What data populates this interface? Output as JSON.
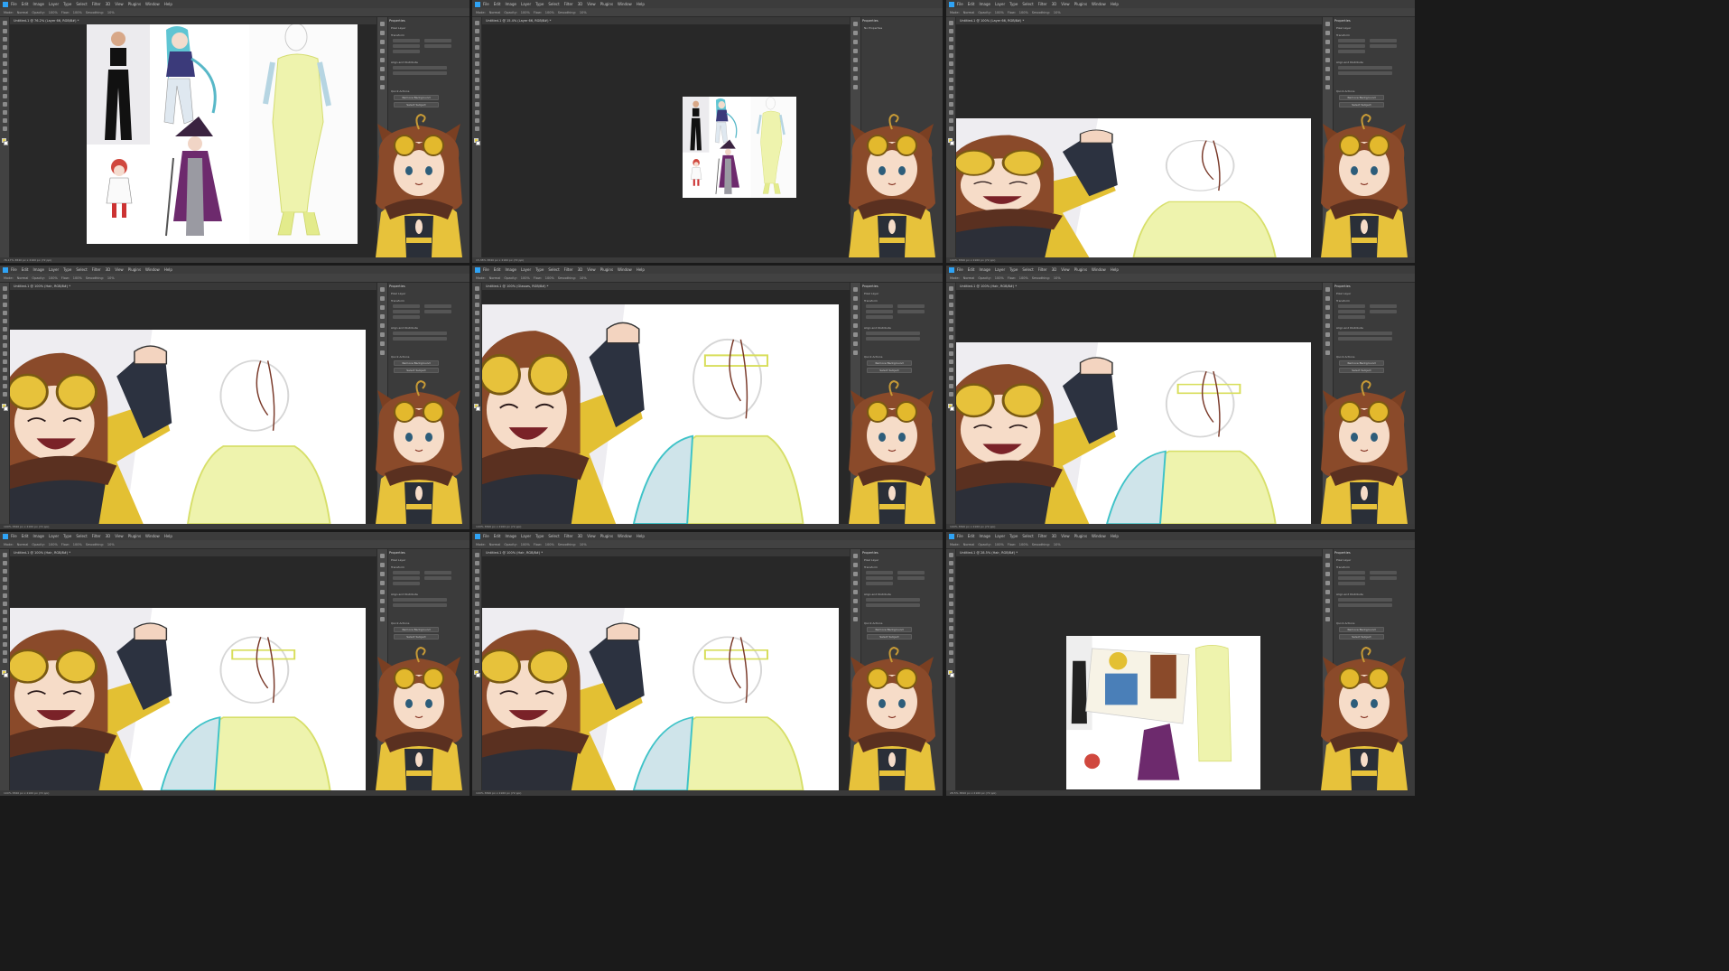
{
  "app": {
    "menu": [
      "File",
      "Edit",
      "Image",
      "Layer",
      "Type",
      "Select",
      "Filter",
      "3D",
      "View",
      "Plugins",
      "Window",
      "Help"
    ],
    "options_labels": [
      "Mode:",
      "Normal",
      "Opacity:",
      "100%",
      "Flow:",
      "100%",
      "Smoothing:",
      "10%"
    ]
  },
  "panels": [
    {
      "doc_tab": "Untitled-1 @ 76.2% (Layer 66, RGB/8#) *",
      "status": "76.17%  3840 px x 2160 px (72 ppi)",
      "props_title": "Properties",
      "props_sub": "Pixel Layer",
      "section1": "Transform",
      "section2": "Align and Distribute",
      "section3": "Quick Actions",
      "btn1": "Remove Background",
      "btn2": "Select Subject"
    },
    {
      "doc_tab": "Untitled-1 @ 15.4% (Layer 66, RGB/8#) *",
      "status": "15.38%  3840 px x 2160 px (72 ppi)",
      "props_title": "Properties",
      "props_sub": "No Properties",
      "section1": "",
      "section2": "",
      "section3": "",
      "btn1": "",
      "btn2": ""
    },
    {
      "doc_tab": "Untitled-1 @ 100% (Layer 66, RGB/8#) *",
      "status": "100%  3840 px x 2160 px (72 ppi)",
      "props_title": "Properties",
      "props_sub": "Pixel Layer",
      "section1": "Transform",
      "section2": "Align and Distribute",
      "section3": "Quick Actions",
      "btn1": "Remove Background",
      "btn2": "Select Subject"
    },
    {
      "doc_tab": "Untitled-1 @ 100% (Hair, RGB/8#) *",
      "status": "100%  3840 px x 2160 px (72 ppi)",
      "props_title": "Properties",
      "props_sub": "Pixel Layer",
      "section1": "Transform",
      "section2": "Align and Distribute",
      "section3": "Quick Actions",
      "btn1": "Remove Background",
      "btn2": "Select Subject"
    },
    {
      "doc_tab": "Untitled-1 @ 100% (Glasses, RGB/8#) *",
      "status": "100%  3840 px x 2160 px (72 ppi)",
      "props_title": "Properties",
      "props_sub": "Pixel Layer",
      "section1": "Transform",
      "section2": "Align and Distribute",
      "section3": "Quick Actions",
      "btn1": "Remove Background",
      "btn2": "Select Subject"
    },
    {
      "doc_tab": "Untitled-1 @ 100% (Hair, RGB/8#) *",
      "status": "100%  3840 px x 2160 px (72 ppi)",
      "props_title": "Properties",
      "props_sub": "Pixel Layer",
      "section1": "Transform",
      "section2": "Align and Distribute",
      "section3": "Quick Actions",
      "btn1": "Remove Background",
      "btn2": "Select Subject"
    },
    {
      "doc_tab": "Untitled-1 @ 100% (Hair, RGB/8#) *",
      "status": "100%  3840 px x 2160 px (72 ppi)",
      "props_title": "Properties",
      "props_sub": "Pixel Layer",
      "section1": "Transform",
      "section2": "Align and Distribute",
      "section3": "Quick Actions",
      "btn1": "Remove Background",
      "btn2": "Select Subject"
    },
    {
      "doc_tab": "Untitled-1 @ 100% (Hair, RGB/8#) *",
      "status": "100%  3840 px x 2160 px (72 ppi)",
      "props_title": "Properties",
      "props_sub": "Pixel Layer",
      "section1": "Transform",
      "section2": "Align and Distribute",
      "section3": "Quick Actions",
      "btn1": "Remove Background",
      "btn2": "Select Subject"
    },
    {
      "doc_tab": "Untitled-1 @ 28.5% (Hair, RGB/8#) *",
      "status": "28.5%  3840 px x 2160 px (72 ppi)",
      "props_title": "Properties",
      "props_sub": "Pixel Layer",
      "section1": "Transform",
      "section2": "Align and Distribute",
      "section3": "Quick Actions",
      "btn1": "Remove Background",
      "btn2": "Select Subject"
    }
  ],
  "colors": {
    "ui_dark": "#282828",
    "ui_panel": "#3b3b3b",
    "mascot_yellow": "#e7c23b",
    "mascot_hair": "#8a4a2a",
    "sketch_yellow": "#e9ef9a",
    "sketch_teal": "#3fc3c8"
  }
}
